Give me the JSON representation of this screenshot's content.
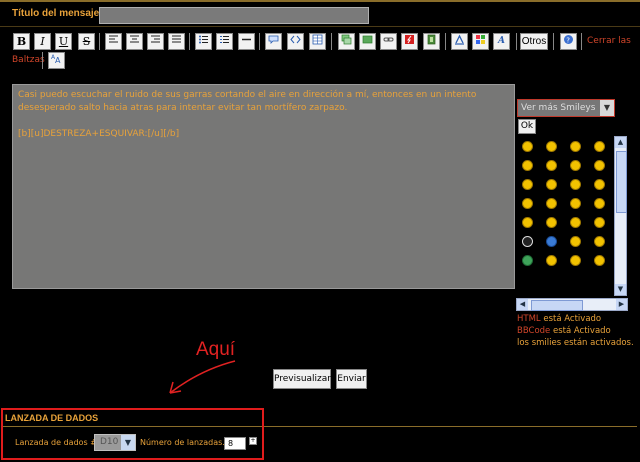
{
  "post": {
    "subject_label": "Título del mensaje",
    "subject_value": "",
    "body_line1": "Casi puedo escuchar el ruido de sus garras cortando el aire en dirección a mí, entonces en un intento desesperado salto hacia atras para intentar evitar tan mortífero zarpazo.",
    "body_line2": "[b][u]DESTREZA+ESQUIVAR:[/u][/b]"
  },
  "toolbar": {
    "bold": "B",
    "italic": "I",
    "underline": "U",
    "strike": "S",
    "others_label": "Otros",
    "close_tags_label": "Cerrar las Baltzas"
  },
  "smileys": {
    "select_value": "Ver más Smileys",
    "ok_label": "Ok"
  },
  "status": {
    "html_prefix": "HTML",
    "html_suffix": " está Activado",
    "bbcode_prefix": "BBCode",
    "bbcode_suffix": " está Activado",
    "smilies_text": "los smilies están activados."
  },
  "annotation": {
    "text": "Aquí",
    "color": "#e12222"
  },
  "actions": {
    "preview_label": "Previsualizar",
    "send_label": "Enviar"
  },
  "dice": {
    "section_title": "LANZADA DE DADOS",
    "roll_label": "Lanzada de dados #1 :",
    "die_value": "D10",
    "count_label": "Número de lanzadas. :",
    "count_value": "8"
  },
  "colors": {
    "accent": "#e8a23a",
    "link_red": "#d0452a",
    "highlight_box": "#e01c1c"
  }
}
